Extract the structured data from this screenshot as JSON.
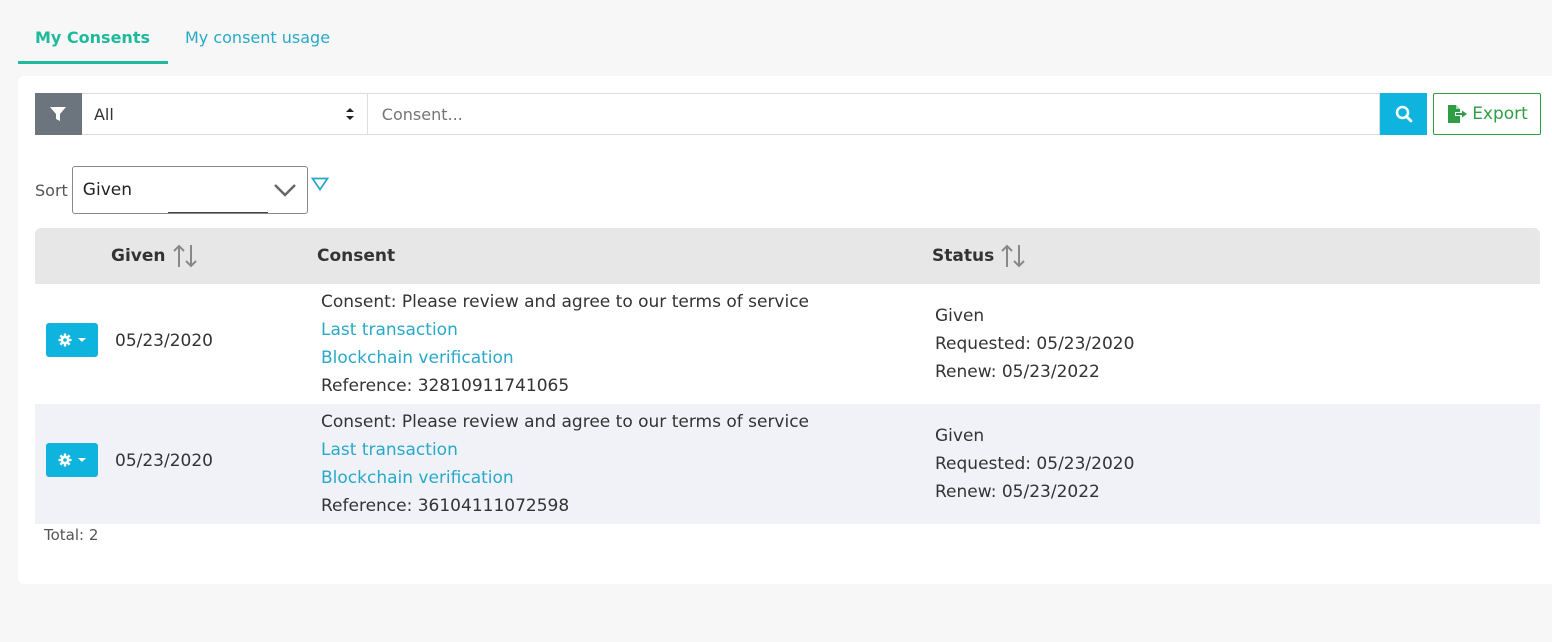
{
  "tabs": [
    {
      "label": "My Consents",
      "active": true
    },
    {
      "label": "My consent usage",
      "active": false
    }
  ],
  "filter": {
    "selected": "All",
    "search_placeholder": "Consent...",
    "export_label": "Export"
  },
  "sort": {
    "label": "Sort",
    "selected": "Given"
  },
  "table": {
    "headers": {
      "given": "Given",
      "consent": "Consent",
      "status": "Status"
    },
    "rows": [
      {
        "date": "05/23/2020",
        "consent_text": "Consent: Please review and agree to our terms of service",
        "last_transaction": "Last transaction",
        "blockchain": "Blockchain verification",
        "reference": "Reference: 32810911741065",
        "status": "Given",
        "requested": "Requested: 05/23/2020",
        "renew": "Renew: 05/23/2022"
      },
      {
        "date": "05/23/2020",
        "consent_text": "Consent: Please review and agree to our terms of service",
        "last_transaction": "Last transaction",
        "blockchain": "Blockchain verification",
        "reference": "Reference: 36104111072598",
        "status": "Given",
        "requested": "Requested: 05/23/2020",
        "renew": "Renew: 05/23/2022"
      }
    ]
  },
  "total": "Total: 2",
  "colors": {
    "accent_green": "#1fb99c",
    "link_blue": "#29a9c9",
    "button_cyan": "#0eb3de",
    "export_green": "#2e9e45",
    "filter_gray": "#6c757d"
  }
}
